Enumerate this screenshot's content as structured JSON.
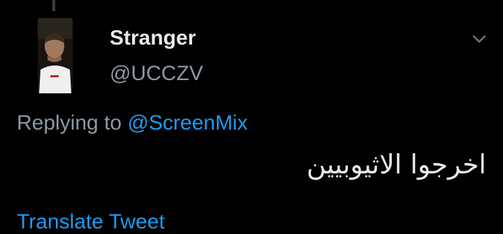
{
  "tweet": {
    "display_name": "Stranger",
    "handle": "@UCCZV",
    "reply_prefix": "Replying to ",
    "reply_to": "@ScreenMix",
    "text": "اخرجوا الاثيوبيين",
    "translate_label": "Translate Tweet"
  },
  "icons": {
    "more": "chevron-down-icon",
    "avatar": "profile-photo"
  },
  "colors": {
    "background": "#000000",
    "primary_text": "#e7e9ea",
    "secondary_text": "#8b98a5",
    "link": "#1d9bf0"
  }
}
